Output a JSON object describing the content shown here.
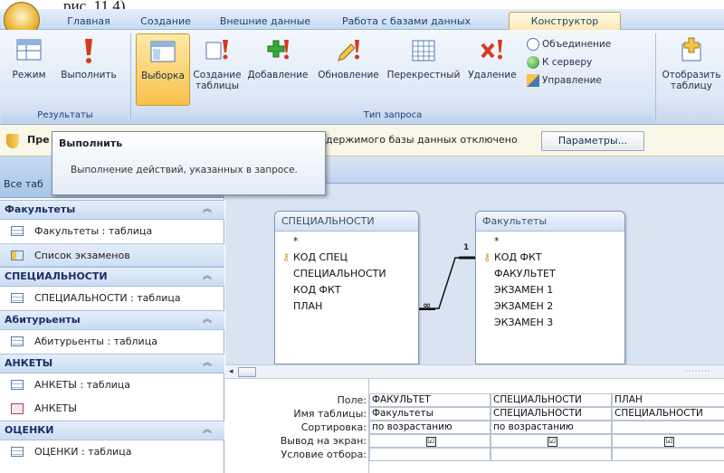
{
  "doc_fragment": "рис. 11.4).",
  "tabs": [
    "Главная",
    "Создание",
    "Внешние данные",
    "Работа с базами данных",
    "Конструктор"
  ],
  "ribbon": {
    "results_group": "Результаты",
    "query_type_group": "Тип запроса",
    "buttons": {
      "mode": "Режим",
      "run": "Выполнить",
      "select": "Выборка",
      "make_table_1": "Создание",
      "make_table_2": "таблицы",
      "append": "Добавление",
      "update": "Обновление",
      "crosstab": "Перекрестный",
      "delete": "Удаление",
      "union": "Объединение",
      "to_server": "К серверу",
      "manage": "Управление",
      "show_table_1": "Отобразить",
      "show_table_2": "таблицу"
    }
  },
  "message_bar": {
    "prefix": "Пре",
    "text": "держимого базы данных отключено",
    "params_button": "Параметры..."
  },
  "tooltip": {
    "title": "Выполнить",
    "text": "Выполнение действий, указанных в запросе."
  },
  "nav": {
    "header": "Все таб",
    "groups": [
      {
        "name": "Факультеты",
        "items": [
          {
            "label": "Факультеты : таблица",
            "type": "table"
          },
          {
            "label": "Список экзаменов",
            "type": "query",
            "selected": true
          }
        ]
      },
      {
        "name": "СПЕЦИАЛЬНОСТИ",
        "items": [
          {
            "label": "СПЕЦИАЛЬНОСТИ : таблица",
            "type": "table"
          }
        ]
      },
      {
        "name": "Абитурьенты",
        "items": [
          {
            "label": "Абитурьенты : таблица",
            "type": "table"
          }
        ]
      },
      {
        "name": "АНКЕТЫ",
        "items": [
          {
            "label": "АНКЕТЫ : таблица",
            "type": "table"
          },
          {
            "label": "АНКЕТЫ",
            "type": "form"
          }
        ]
      },
      {
        "name": "ОЦЕНКИ",
        "items": [
          {
            "label": "ОЦЕНКИ : таблица",
            "type": "table"
          }
        ]
      }
    ]
  },
  "tables": [
    {
      "title": "СПЕЦИАЛЬНОСТИ",
      "fields": [
        "*",
        "КОД СПЕЦ",
        "СПЕЦИАЛЬНОСТИ",
        "КОД ФКТ",
        "ПЛАН"
      ],
      "key_index": 1
    },
    {
      "title": "Факультеты",
      "fields": [
        "*",
        "КОД ФКТ",
        "ФАКУЛЬТЕТ",
        "ЭКЗАМЕН 1",
        "ЭКЗАМЕН 2",
        "ЭКЗАМЕН 3"
      ],
      "key_index": 1
    }
  ],
  "relation": {
    "one": "1",
    "many": "∞"
  },
  "grid": {
    "row_labels": [
      "Поле:",
      "Имя таблицы:",
      "Сортировка:",
      "Вывод на экран:",
      "Условие отбора:"
    ],
    "columns": [
      {
        "field": "ФАКУЛЬТЕТ",
        "table": "Факультеты",
        "sort": "по возрастанию",
        "show": "☑"
      },
      {
        "field": "СПЕЦИАЛЬНОСТИ",
        "table": "СПЕЦИАЛЬНОСТИ",
        "sort": "по возрастанию",
        "show": "☑"
      },
      {
        "field": "ПЛАН",
        "table": "СПЕЦИАЛЬНОСТИ",
        "sort": "",
        "show": "☑"
      }
    ]
  }
}
